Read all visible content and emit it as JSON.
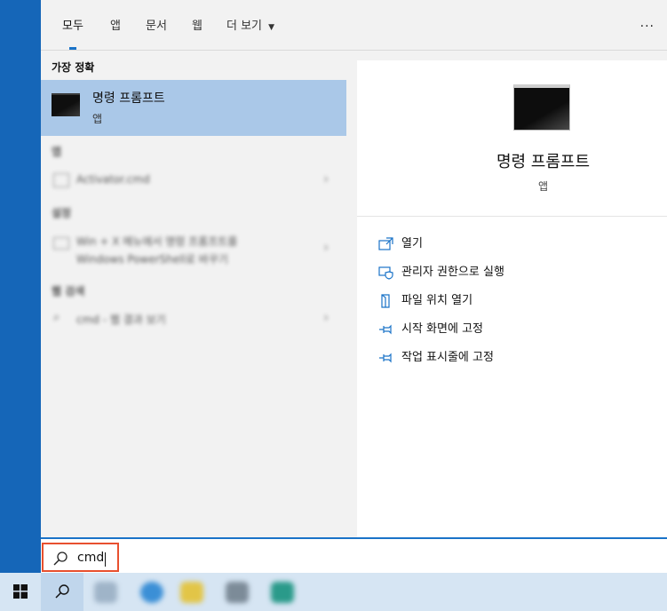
{
  "tabs": [
    {
      "label": "모두",
      "active": true
    },
    {
      "label": "앱",
      "active": false
    },
    {
      "label": "문서",
      "active": false
    },
    {
      "label": "웹",
      "active": false
    },
    {
      "label": "더 보기",
      "active": false
    }
  ],
  "more_options_icon": "ellipsis-icon",
  "best_match": {
    "section": "가장 정확",
    "title": "명령 프롬프트",
    "subtitle": "앱"
  },
  "blurred": {
    "apps_section": "앱",
    "app_item": "Activator.cmd",
    "settings_section": "설정",
    "settings_item_line1": "Win + X 메뉴에서 명령 프롬프트를",
    "settings_item_line2": "Windows PowerShell로 바꾸기",
    "web_section": "웹 검색",
    "web_item": "cmd - 웹 결과 보기"
  },
  "detail": {
    "title": "명령 프롬프트",
    "subtitle": "앱",
    "actions": [
      {
        "label": "열기",
        "icon": "open-icon"
      },
      {
        "label": "관리자 권한으로 실행",
        "icon": "shield-icon"
      },
      {
        "label": "파일 위치 열기",
        "icon": "file-location-icon"
      },
      {
        "label": "시작 화면에 고정",
        "icon": "pin-icon"
      },
      {
        "label": "작업 표시줄에 고정",
        "icon": "pin-icon"
      }
    ]
  },
  "search": {
    "value": "cmd"
  },
  "colors": {
    "accent": "#1a73c8",
    "highlight": "#aac8e8",
    "search_border": "#e8502f",
    "desktop": "#1566b8"
  }
}
